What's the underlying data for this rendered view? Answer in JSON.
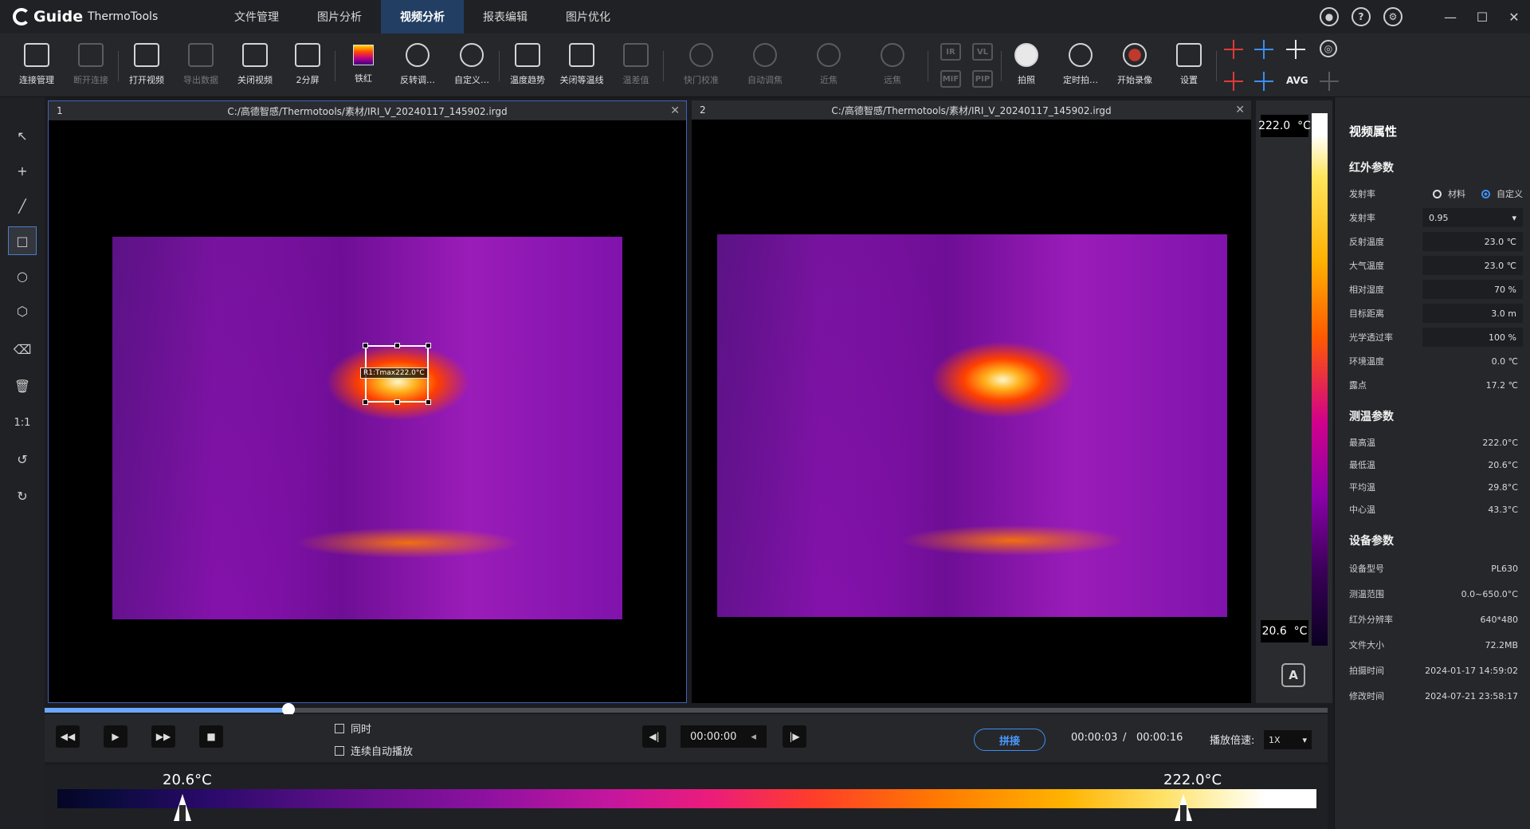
{
  "app": {
    "brand": "Guide",
    "name": "ThermoTools"
  },
  "nav": [
    {
      "label": "文件管理"
    },
    {
      "label": "图片分析"
    },
    {
      "label": "视频分析",
      "active": true
    },
    {
      "label": "报表编辑"
    },
    {
      "label": "图片优化"
    }
  ],
  "title_icons": [
    "user-icon",
    "help-icon",
    "settings-icon"
  ],
  "window_controls": {
    "minimize": "—",
    "maximize": "☐",
    "close": "✕"
  },
  "toolbar": [
    {
      "label": "连接管理",
      "icon": "connection-icon",
      "enabled": true
    },
    {
      "label": "断开连接",
      "icon": "disconnect-icon",
      "enabled": false
    },
    {
      "label": "打开视频",
      "icon": "open-video-icon",
      "enabled": true
    },
    {
      "label": "导出数据",
      "icon": "export-data-icon",
      "enabled": false
    },
    {
      "label": "关闭视频",
      "icon": "close-video-icon",
      "enabled": true
    },
    {
      "label": "2分屏",
      "icon": "split-screen-icon",
      "enabled": true
    },
    {
      "label": "铁红",
      "icon": "palette-icon",
      "enabled": true
    },
    {
      "label": "反转调…",
      "icon": "invert-icon",
      "enabled": true
    },
    {
      "label": "自定义…",
      "icon": "custom-icon",
      "enabled": true
    },
    {
      "label": "温度趋势",
      "icon": "trend-icon",
      "enabled": true
    },
    {
      "label": "关闭等温线",
      "icon": "isotherm-icon",
      "enabled": true
    },
    {
      "label": "温差值",
      "icon": "delta-icon",
      "enabled": false
    },
    {
      "label": "快门校准",
      "icon": "shutter-icon",
      "enabled": false
    },
    {
      "label": "自动调焦",
      "icon": "autofocus-icon",
      "enabled": false
    },
    {
      "label": "近焦",
      "icon": "near-focus-icon",
      "enabled": false
    },
    {
      "label": "远焦",
      "icon": "far-focus-icon",
      "enabled": false
    },
    {
      "label": "拍照",
      "icon": "capture-icon",
      "enabled": true
    },
    {
      "label": "定时拍…",
      "icon": "timer-capture-icon",
      "enabled": true
    },
    {
      "label": "开始录像",
      "icon": "record-icon",
      "enabled": true
    },
    {
      "label": "设置",
      "icon": "camera-settings-icon",
      "enabled": true
    }
  ],
  "mode_buttons": [
    "IR",
    "VL",
    "MIF",
    "PIP"
  ],
  "avg_label": "AVG",
  "views": [
    {
      "num": "1",
      "path": "C:/高德智感/Thermotools/素材/IRI_V_20240117_145902.irgd",
      "close": "✕",
      "roi_label": "R1:Tmax222.0°C"
    },
    {
      "num": "2",
      "path": "C:/高德智感/Thermotools/素材/IRI_V_20240117_145902.irgd",
      "close": "✕"
    }
  ],
  "scale": {
    "max": "222.0",
    "min": "20.6",
    "unit": "°C",
    "auto": "A"
  },
  "left_tools": [
    {
      "name": "select-arrow-icon",
      "glyph": "↖"
    },
    {
      "name": "point-tool-icon",
      "glyph": "+"
    },
    {
      "name": "line-tool-icon",
      "glyph": "╱"
    },
    {
      "name": "rectangle-tool-icon",
      "glyph": "□"
    },
    {
      "name": "circle-tool-icon",
      "glyph": "○"
    },
    {
      "name": "polygon-tool-icon",
      "glyph": "⬡"
    },
    {
      "name": "eraser-icon",
      "glyph": "⌫"
    },
    {
      "name": "delete-icon",
      "glyph": "🗑"
    },
    {
      "name": "zoom-1to1-icon",
      "glyph": "1:1"
    },
    {
      "name": "rotate-left-icon",
      "glyph": "↺"
    },
    {
      "name": "rotate-right-icon",
      "glyph": "↻"
    }
  ],
  "panel": {
    "title": "视频属性",
    "ir_section": "红外参数",
    "emissivity_mode": {
      "label": "发射率",
      "opt1": "材料",
      "opt2": "自定义"
    },
    "ir_params": [
      {
        "key": "发射率",
        "value": "0.95",
        "dropdown": true
      },
      {
        "key": "反射温度",
        "value": "23.0 ℃"
      },
      {
        "key": "大气温度",
        "value": "23.0 ℃"
      },
      {
        "key": "相对湿度",
        "value": "70 %"
      },
      {
        "key": "目标距离",
        "value": "3.0 m"
      },
      {
        "key": "光学透过率",
        "value": "100 %"
      },
      {
        "key": "环境温度",
        "value": "0.0 ℃",
        "plain": true
      },
      {
        "key": "露点",
        "value": "17.2 ℃",
        "plain": true
      }
    ],
    "measure_section": "测温参数",
    "measure": [
      {
        "key": "最高温",
        "value": "222.0°C"
      },
      {
        "key": "最低温",
        "value": "20.6°C"
      },
      {
        "key": "平均温",
        "value": "29.8°C"
      },
      {
        "key": "中心温",
        "value": "43.3°C"
      }
    ],
    "device_section": "设备参数",
    "device": [
      {
        "key": "设备型号",
        "value": "PL630"
      },
      {
        "key": "测温范围",
        "value": "0.0~650.0°C"
      },
      {
        "key": "红外分辨率",
        "value": "640*480"
      },
      {
        "key": "文件大小",
        "value": "72.2MB"
      },
      {
        "key": "拍摄时间",
        "value": "2024-01-17 14:59:02"
      },
      {
        "key": "修改时间",
        "value": "2024-07-21 23:58:17"
      }
    ]
  },
  "playback": {
    "sync_label": "同时",
    "autoplay_label": "连续自动播放",
    "frame_time": "00:00:00",
    "stitch_label": "拼接",
    "current": "00:00:03",
    "sep": "/",
    "total": "00:00:16",
    "speed_label": "播放倍速:",
    "speed": "1X",
    "progress": 0.19
  },
  "range": {
    "low": "20.6°C",
    "high": "222.0°C"
  }
}
